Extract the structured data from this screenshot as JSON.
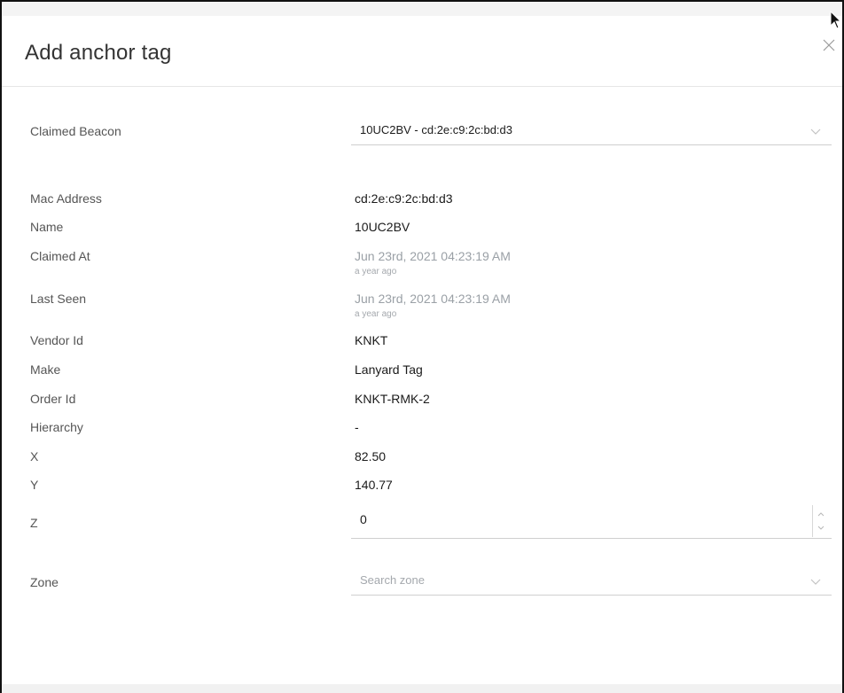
{
  "dialog": {
    "title": "Add anchor tag",
    "close_icon": "close-icon"
  },
  "claimed_beacon": {
    "label": "Claimed Beacon",
    "selected": "10UC2BV - cd:2e:c9:2c:bd:d3"
  },
  "fields": {
    "mac_address": {
      "label": "Mac Address",
      "value": "cd:2e:c9:2c:bd:d3"
    },
    "name": {
      "label": "Name",
      "value": "10UC2BV"
    },
    "claimed_at": {
      "label": "Claimed At",
      "value": "Jun 23rd, 2021 04:23:19 AM",
      "relative": "a year ago"
    },
    "last_seen": {
      "label": "Last Seen",
      "value": "Jun 23rd, 2021 04:23:19 AM",
      "relative": "a year ago"
    },
    "vendor_id": {
      "label": "Vendor Id",
      "value": "KNKT"
    },
    "make": {
      "label": "Make",
      "value": "Lanyard Tag"
    },
    "order_id": {
      "label": "Order Id",
      "value": "KNKT-RMK-2"
    },
    "hierarchy": {
      "label": "Hierarchy",
      "value": "-"
    },
    "x": {
      "label": "X",
      "value": "82.50"
    },
    "y": {
      "label": "Y",
      "value": "140.77"
    },
    "z": {
      "label": "Z",
      "value": "0"
    }
  },
  "zone": {
    "label": "Zone",
    "placeholder": "Search zone"
  }
}
